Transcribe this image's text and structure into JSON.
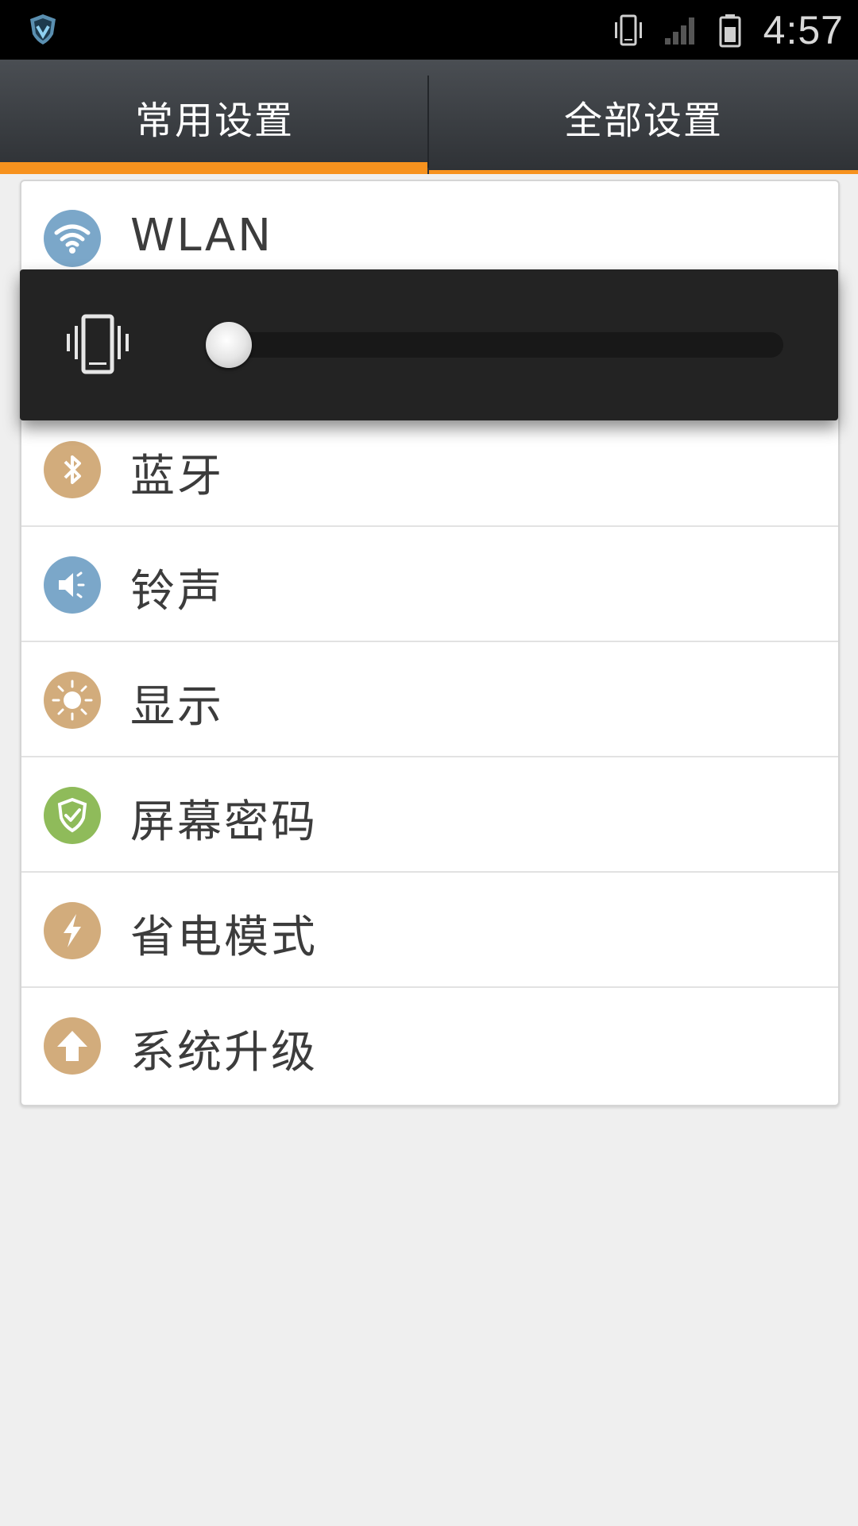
{
  "status_bar": {
    "app_icon": "shield-app-icon",
    "icons": [
      "vibrate-icon",
      "signal-icon",
      "battery-icon"
    ],
    "time": "4:57"
  },
  "tabs": [
    {
      "label": "常用设置",
      "active": true
    },
    {
      "label": "全部设置",
      "active": false
    }
  ],
  "accent_color": "#f7921e",
  "settings": [
    {
      "label": "WLAN",
      "icon": "wifi-icon",
      "color": "#7ba7c9"
    },
    {
      "label": "蓝牙",
      "icon": "bluetooth-icon",
      "color": "#d2ac7c"
    },
    {
      "label": "铃声",
      "icon": "speaker-icon",
      "color": "#7ba7c9"
    },
    {
      "label": "显示",
      "icon": "sun-icon",
      "color": "#d2ac7c"
    },
    {
      "label": "屏幕密码",
      "icon": "shield-check-icon",
      "color": "#8fbb5a"
    },
    {
      "label": "省电模式",
      "icon": "lightning-icon",
      "color": "#d2ac7c"
    },
    {
      "label": "系统升级",
      "icon": "up-arrow-icon",
      "color": "#d2ac7c"
    }
  ],
  "volume_overlay": {
    "icon": "vibrate-icon",
    "level": 0
  }
}
